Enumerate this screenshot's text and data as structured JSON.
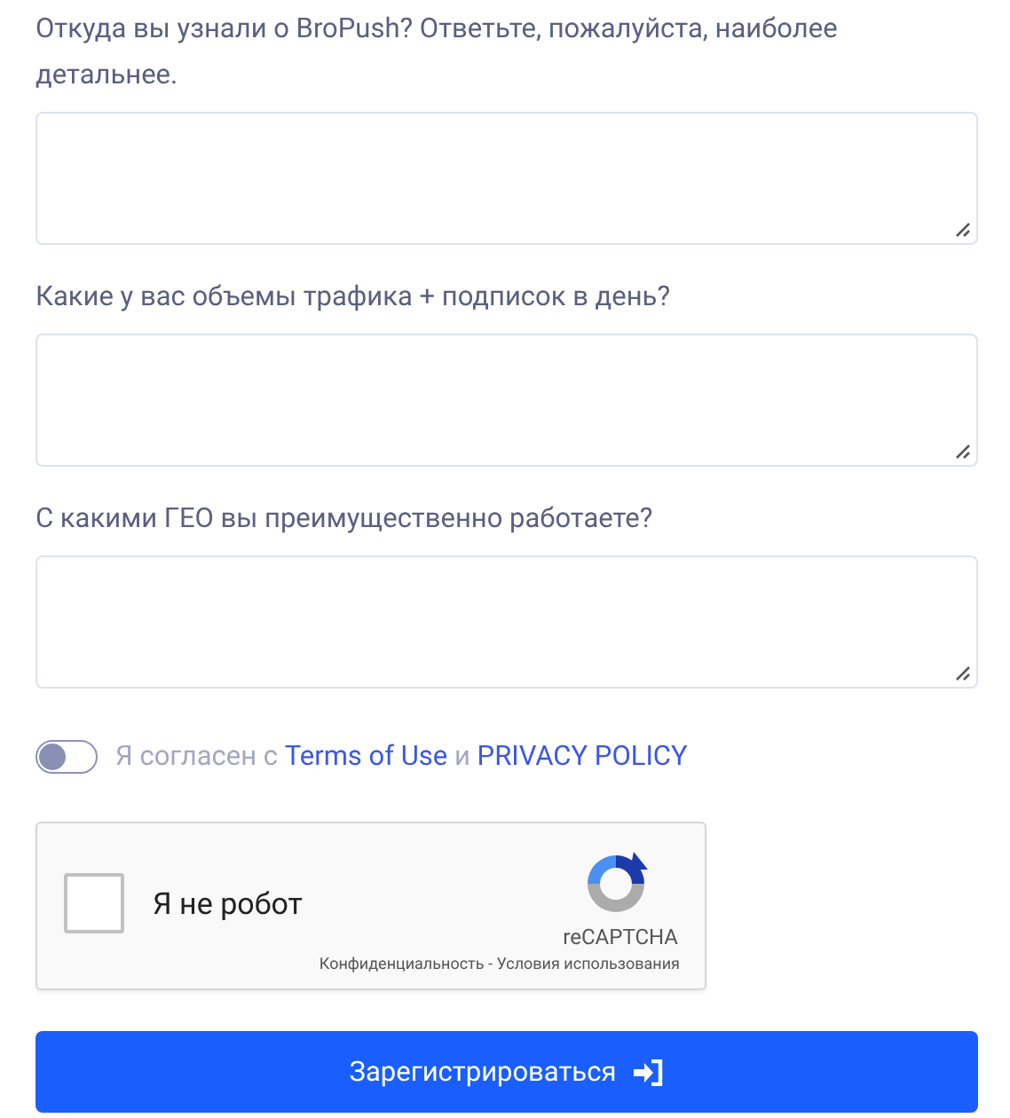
{
  "questions": [
    {
      "label": "Откуда вы узнали о BroPush? Ответьте, пожалуйста, наиболее детальнее."
    },
    {
      "label": "Какие у вас объемы трафика + подписок в день?"
    },
    {
      "label": "С какими ГЕО вы преимущественно работаете?"
    }
  ],
  "consent": {
    "on": false,
    "prefix": "Я согласен с",
    "terms_link": "Terms of Use",
    "conjunction": "и",
    "privacy_link": "PRIVACY POLICY"
  },
  "captcha": {
    "checked": false,
    "label": "Я не робот",
    "brand": "reCAPTCHA",
    "privacy_link": "Конфиденциальность",
    "separator": "-",
    "terms_link": "Условия использования"
  },
  "submit": {
    "label": "Зарегистрироваться"
  }
}
